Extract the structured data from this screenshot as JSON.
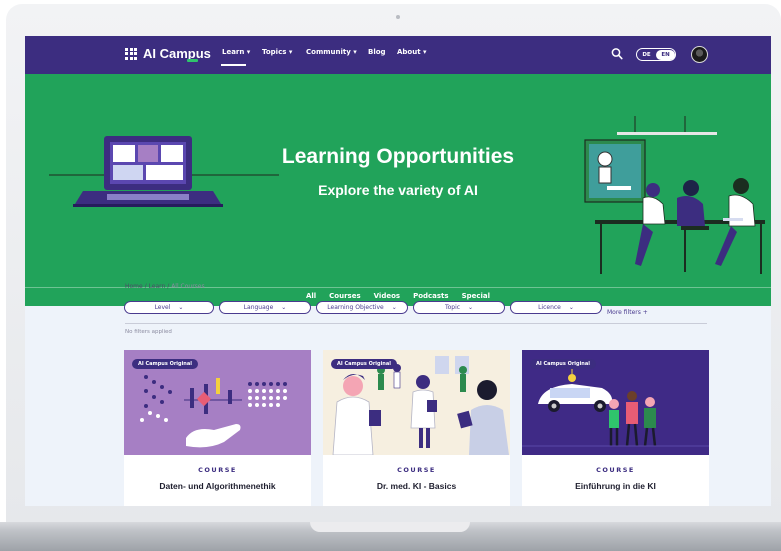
{
  "nav": {
    "logo": "AI Campus",
    "items": [
      "Learn",
      "Topics",
      "Community",
      "Blog",
      "About"
    ],
    "lang": {
      "left": "DE",
      "right": "EN"
    }
  },
  "hero": {
    "title": "Learning Opportunities",
    "subtitle": "Explore the variety of AI",
    "tabs": [
      "All",
      "Courses",
      "Videos",
      "Podcasts",
      "Special"
    ],
    "active_tab": "Courses"
  },
  "breadcrumb": {
    "home": "Home",
    "learn": "Learn",
    "current": "All Courses"
  },
  "filters": {
    "items": [
      "Level",
      "Language",
      "Learning Objective",
      "Topic",
      "Licence"
    ],
    "more": "More filters +",
    "status": "No filters applied"
  },
  "cards": [
    {
      "badge": "AI Campus Original",
      "type": "COURSE",
      "title": "Daten- und Algorithmenethik",
      "bg": "#a67fc4"
    },
    {
      "badge": "AI Campus Original",
      "type": "COURSE",
      "title": "Dr. med. KI - Basics",
      "bg": "#f6efe0"
    },
    {
      "badge": "AI Campus Original",
      "type": "COURSE",
      "title": "Einführung in die KI",
      "bg": "#3f2a86"
    }
  ],
  "colors": {
    "nav": "#3c2d80",
    "hero": "#21a35a",
    "accent": "#2fc46c"
  }
}
